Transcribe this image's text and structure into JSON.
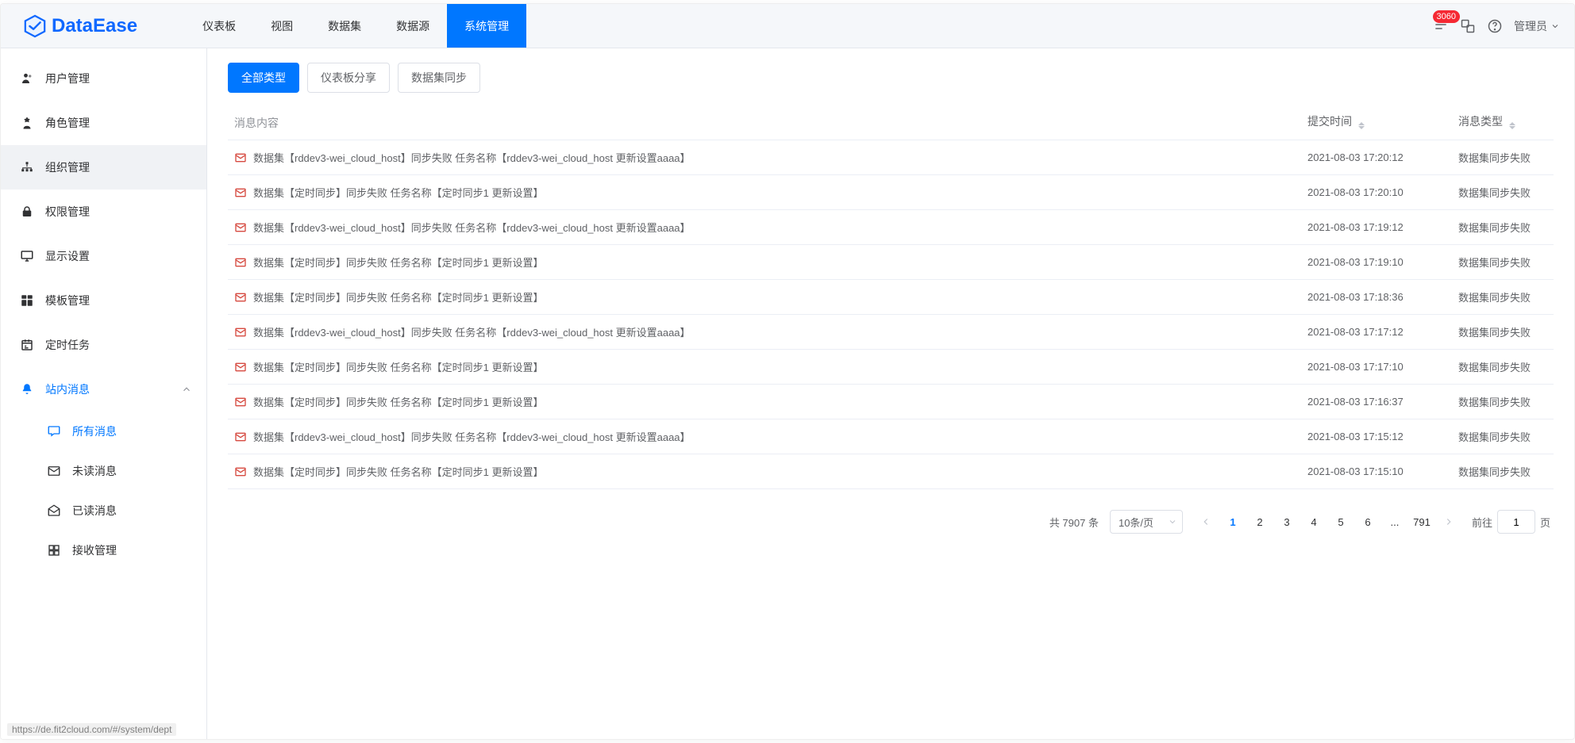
{
  "logo_name": "DataEase",
  "nav": [
    {
      "label": "仪表板"
    },
    {
      "label": "视图"
    },
    {
      "label": "数据集"
    },
    {
      "label": "数据源"
    },
    {
      "label": "系统管理",
      "active": true
    }
  ],
  "badge_count": "3060",
  "user_label": "管理员",
  "sidebar": {
    "items": [
      {
        "label": "用户管理",
        "icon": "user"
      },
      {
        "label": "角色管理",
        "icon": "role"
      },
      {
        "label": "组织管理",
        "icon": "org",
        "active_bg": true
      },
      {
        "label": "权限管理",
        "icon": "lock"
      },
      {
        "label": "显示设置",
        "icon": "display"
      },
      {
        "label": "模板管理",
        "icon": "template"
      },
      {
        "label": "定时任务",
        "icon": "task"
      },
      {
        "label": "站内消息",
        "icon": "bell",
        "highlight": true,
        "expandable": true
      }
    ],
    "submenu": [
      {
        "label": "所有消息",
        "icon": "chat",
        "active": true
      },
      {
        "label": "未读消息",
        "icon": "mail"
      },
      {
        "label": "已读消息",
        "icon": "mailopen"
      },
      {
        "label": "接收管理",
        "icon": "grid"
      }
    ]
  },
  "filters": [
    {
      "label": "全部类型",
      "active": true
    },
    {
      "label": "仪表板分享"
    },
    {
      "label": "数据集同步"
    }
  ],
  "columns": {
    "msg": "消息内容",
    "time": "提交时间",
    "type": "消息类型"
  },
  "rows": [
    {
      "msg": "数据集【rddev3-wei_cloud_host】同步失败 任务名称【rddev3-wei_cloud_host 更新设置aaaa】",
      "time": "2021-08-03 17:20:12",
      "type": "数据集同步失败"
    },
    {
      "msg": "数据集【定时同步】同步失败 任务名称【定时同步1 更新设置】",
      "time": "2021-08-03 17:20:10",
      "type": "数据集同步失败"
    },
    {
      "msg": "数据集【rddev3-wei_cloud_host】同步失败 任务名称【rddev3-wei_cloud_host 更新设置aaaa】",
      "time": "2021-08-03 17:19:12",
      "type": "数据集同步失败"
    },
    {
      "msg": "数据集【定时同步】同步失败 任务名称【定时同步1 更新设置】",
      "time": "2021-08-03 17:19:10",
      "type": "数据集同步失败"
    },
    {
      "msg": "数据集【定时同步】同步失败 任务名称【定时同步1 更新设置】",
      "time": "2021-08-03 17:18:36",
      "type": "数据集同步失败"
    },
    {
      "msg": "数据集【rddev3-wei_cloud_host】同步失败 任务名称【rddev3-wei_cloud_host 更新设置aaaa】",
      "time": "2021-08-03 17:17:12",
      "type": "数据集同步失败"
    },
    {
      "msg": "数据集【定时同步】同步失败 任务名称【定时同步1 更新设置】",
      "time": "2021-08-03 17:17:10",
      "type": "数据集同步失败"
    },
    {
      "msg": "数据集【定时同步】同步失败 任务名称【定时同步1 更新设置】",
      "time": "2021-08-03 17:16:37",
      "type": "数据集同步失败"
    },
    {
      "msg": "数据集【rddev3-wei_cloud_host】同步失败 任务名称【rddev3-wei_cloud_host 更新设置aaaa】",
      "time": "2021-08-03 17:15:12",
      "type": "数据集同步失败"
    },
    {
      "msg": "数据集【定时同步】同步失败 任务名称【定时同步1 更新设置】",
      "time": "2021-08-03 17:15:10",
      "type": "数据集同步失败"
    }
  ],
  "pager": {
    "total_text": "共 7907 条",
    "size_label": "10条/页",
    "pages": [
      "1",
      "2",
      "3",
      "4",
      "5",
      "6",
      "...",
      "791"
    ],
    "active_page": "1",
    "jump_prefix": "前往",
    "jump_value": "1",
    "jump_suffix": "页"
  },
  "status_link": "https://de.fit2cloud.com/#/system/dept"
}
